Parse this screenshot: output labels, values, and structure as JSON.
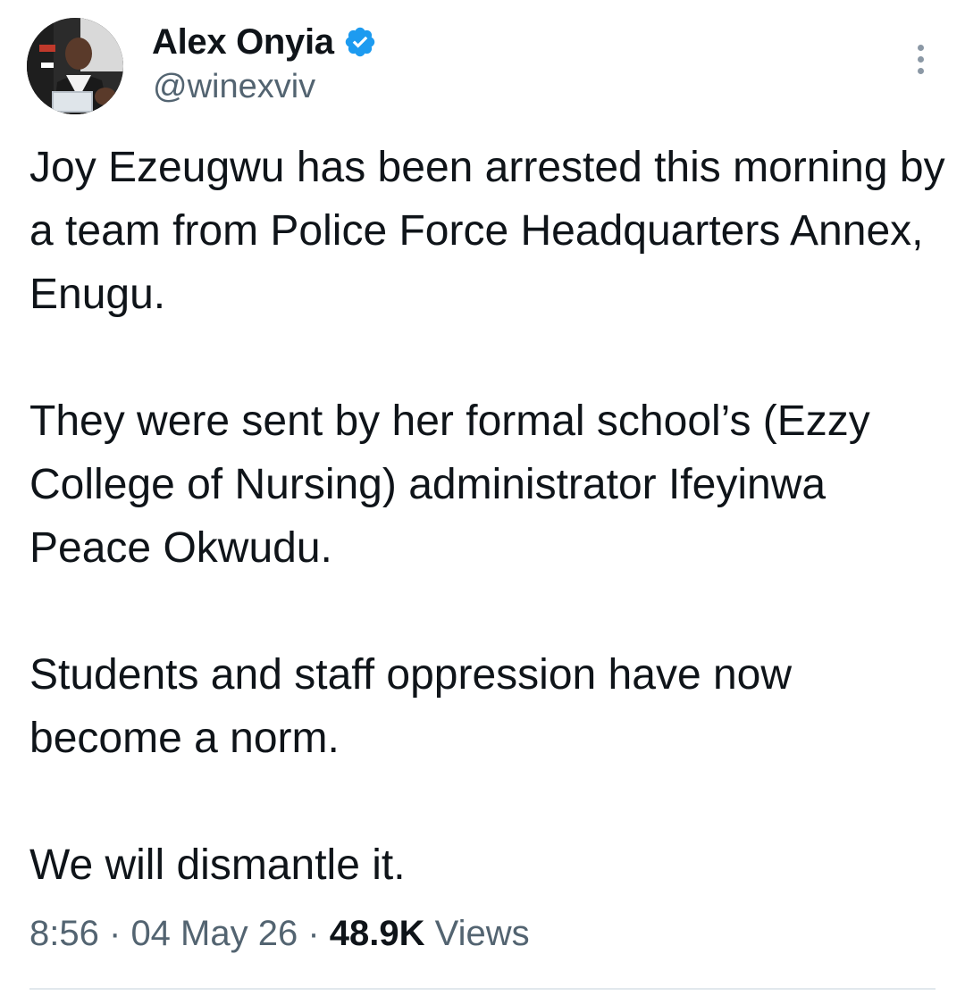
{
  "author": {
    "display_name": "Alex Onyia",
    "handle": "@winexviv",
    "verified": true,
    "avatar_icon": "profile-photo",
    "verified_icon": "verified-badge-icon"
  },
  "colors": {
    "text_primary": "#0f1419",
    "text_secondary": "#536471",
    "verified_blue": "#1d9bf0",
    "divider": "#e1e8ed"
  },
  "tweet": {
    "paragraphs": [
      "Joy Ezeugwu has been arrested this morning by a team from Police Force Headquarters Annex, Enugu.",
      "They were sent by her formal school’s (Ezzy College of Nursing) administrator Ifeyinwa Peace Okwudu.",
      "Students and staff oppression have now become a norm.",
      "We will dismantle it."
    ]
  },
  "meta": {
    "time": "8:56",
    "separator": "·",
    "date": "04 May 26",
    "views_count": "48.9K",
    "views_label": "Views"
  }
}
